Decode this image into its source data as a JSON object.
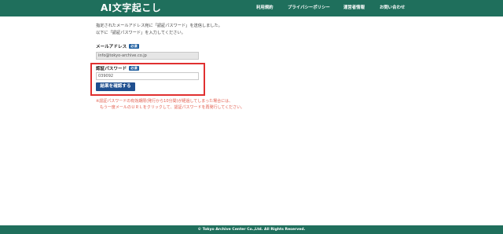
{
  "header": {
    "logo": "AI文字起こし",
    "nav": [
      "利用規約",
      "プライバシーポリシー",
      "運営者情報",
      "お問い合わせ"
    ]
  },
  "intro": {
    "line1": "指定されたメールアドレス宛に「認証パスワード」を送信しました。",
    "line2": "以下に「認証パスワード」を入力してください。"
  },
  "form": {
    "email_label": "メールアドレス",
    "email_required": "必須",
    "email_value": "info@tokyo-archive.co.jp",
    "password_label": "認証パスワード",
    "password_required": "必須",
    "password_value": "039092",
    "submit_label": "結果を確認する"
  },
  "note": {
    "line1": "※認証パスワードの有効期限(発行から10分間)が経過してしまった場合には、",
    "line2": "もう一度メールのＵＲＬをクリックして、認証パスワードを再発行してください。"
  },
  "footer": {
    "copyright": "© Tokyo Archive Center Co.,Ltd. All Rights Reserved."
  },
  "colors": {
    "brand_green": "#1f6f5c",
    "button_blue": "#1f4f8f",
    "highlight_red": "#e03030",
    "note_red": "#e25a4a"
  }
}
